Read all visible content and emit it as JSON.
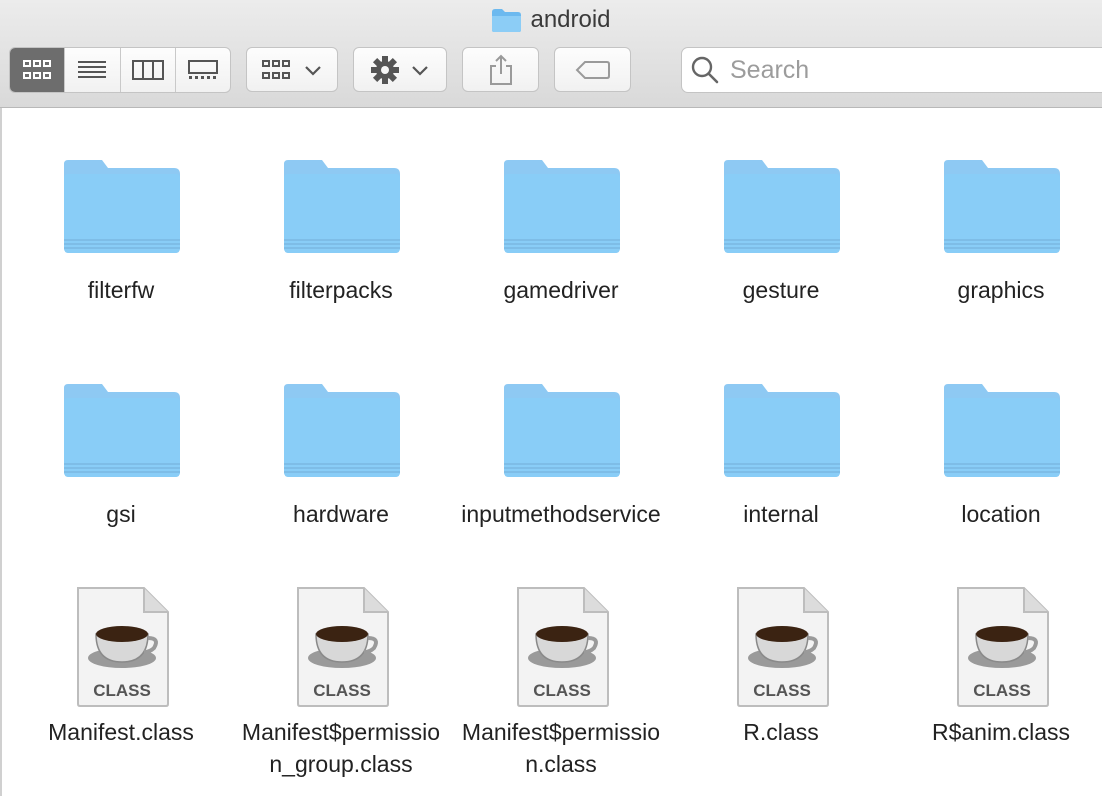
{
  "window": {
    "title": "android"
  },
  "toolbar": {
    "view_modes": [
      {
        "name": "icon-view",
        "active": true
      },
      {
        "name": "list-view",
        "active": false
      },
      {
        "name": "column-view",
        "active": false
      },
      {
        "name": "gallery-view",
        "active": false
      }
    ],
    "search_placeholder": "Search"
  },
  "colors": {
    "folder_body": "#7fc4f2",
    "folder_tab": "#9fd3f6",
    "selected_segment": "#6d6d6d"
  },
  "items": [
    {
      "name": "filterfw",
      "kind": "folder"
    },
    {
      "name": "filterpacks",
      "kind": "folder"
    },
    {
      "name": "gamedriver",
      "kind": "folder"
    },
    {
      "name": "gesture",
      "kind": "folder"
    },
    {
      "name": "graphics",
      "kind": "folder"
    },
    {
      "name": "gsi",
      "kind": "folder"
    },
    {
      "name": "hardware",
      "kind": "folder"
    },
    {
      "name": "inputmethodservice",
      "kind": "folder"
    },
    {
      "name": "internal",
      "kind": "folder"
    },
    {
      "name": "location",
      "kind": "folder"
    },
    {
      "name": "Manifest.class",
      "kind": "class-file",
      "badge": "CLASS"
    },
    {
      "name": "Manifest$permission_group.class",
      "kind": "class-file",
      "badge": "CLASS"
    },
    {
      "name": "Manifest$permission.class",
      "kind": "class-file",
      "badge": "CLASS"
    },
    {
      "name": "R.class",
      "kind": "class-file",
      "badge": "CLASS"
    },
    {
      "name": "R$anim.class",
      "kind": "class-file",
      "badge": "CLASS"
    }
  ]
}
